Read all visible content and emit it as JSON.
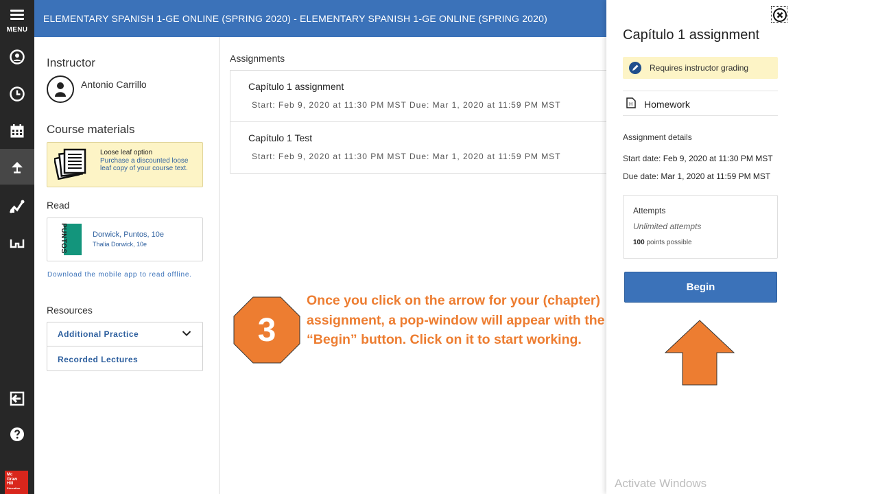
{
  "rail": {
    "menu_label": "MENU",
    "items": [
      {
        "icon": "user-circle-icon"
      },
      {
        "icon": "clock-icon"
      },
      {
        "icon": "calendar-icon"
      },
      {
        "icon": "lamp-icon",
        "active": true
      },
      {
        "icon": "performance-chart-icon"
      },
      {
        "icon": "glasses-icon"
      },
      {
        "icon": "exit-icon"
      },
      {
        "icon": "help-icon"
      }
    ],
    "logo_lines": [
      "Mc",
      "Graw",
      "Hill",
      "Education"
    ]
  },
  "header": {
    "title": "ELEMENTARY SPANISH 1-GE ONLINE (SPRING 2020) - ELEMENTARY SPANISH 1-GE ONLINE (SPRING 2020)"
  },
  "left": {
    "instructor_heading": "Instructor",
    "instructor_name": "Antonio Carrillo",
    "course_materials_heading": "Course materials",
    "loose_leaf_title": "Loose leaf option",
    "loose_leaf_text": "Purchase a discounted loose leaf copy of your course text.",
    "read_heading": "Read",
    "book_cover_text": "PUNTOS",
    "book_title": "Dorwick, Puntos, 10e",
    "book_author": "Thalia Dorwick, 10e",
    "download_text": "Download the mobile app to read offline.",
    "resources_heading": "Resources",
    "resources": [
      "Additional Practice",
      "Recorded Lectures"
    ]
  },
  "assignments": {
    "heading": "Assignments",
    "items": [
      {
        "name": "Capítulo 1 assignment",
        "dates": "Start: Feb 9, 2020 at 11:30 PM MST  Due: Mar 1, 2020 at 11:59 PM MST"
      },
      {
        "name": "Capítulo 1 Test",
        "dates": "Start: Feb 9, 2020 at 11:30 PM MST  Due: Mar 1, 2020 at 11:59 PM MST"
      }
    ]
  },
  "annotation": {
    "step_number": "3",
    "text": "Once you click on the arrow for your (chapter) assignment, a pop-window will appear with the “Begin” button. Click on it to start working.",
    "color": "#ed7d31"
  },
  "panel": {
    "title": "Capítulo 1 assignment",
    "grading_text": "Requires instructor grading",
    "type_label": "Homework",
    "details_heading": "Assignment details",
    "start_label": "Start date:",
    "start_value": "Feb 9, 2020 at 11:30 PM MST",
    "due_label": "Due date:",
    "due_value": "Mar 1, 2020 at 11:59 PM MST",
    "attempts_heading": "Attempts",
    "attempts_value": "Unlimited attempts",
    "points_value": "100",
    "points_label": "points possible",
    "begin_label": "Begin"
  },
  "watermark": "Activate Windows",
  "colors": {
    "brand_blue": "#3b72b9",
    "rail_bg": "#272727",
    "highlight_yellow": "#fdf4c6",
    "annotation_orange": "#ed7d31"
  }
}
